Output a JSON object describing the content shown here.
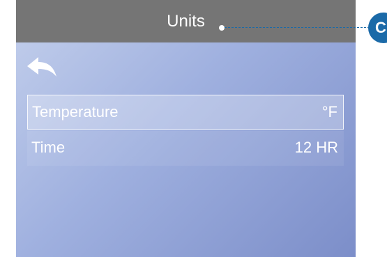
{
  "header": {
    "title": "Units"
  },
  "back_button": {
    "icon": "back-arrow-icon"
  },
  "settings": [
    {
      "label": "Temperature",
      "value": "°F",
      "selected": true
    },
    {
      "label": "Time",
      "value": "12 HR",
      "selected": false
    }
  ],
  "callout": {
    "label": "C"
  },
  "colors": {
    "header_bg": "#757575",
    "screen_gradient_start": "#c4d0ec",
    "screen_gradient_end": "#7c8ec9",
    "callout_blue": "#1b6aa8",
    "text": "#ffffff"
  }
}
